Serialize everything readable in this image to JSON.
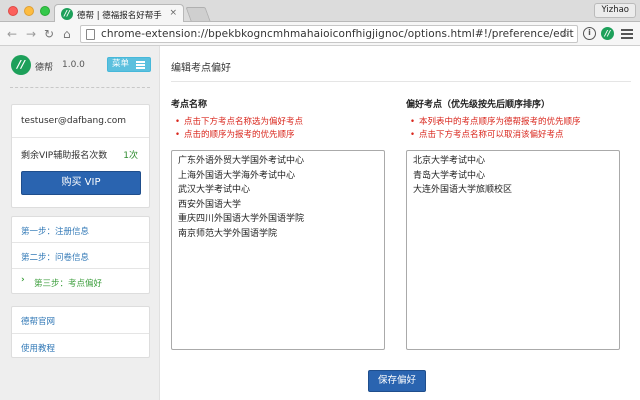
{
  "browser": {
    "tab_title": "德帮 | 德福报名好帮手",
    "tab_favicon_letter": "//",
    "tab_close": "×",
    "user_name": "Yizhao",
    "url": "chrome-extension://bpekbkogncmhmahaioiconfhigjignoc/options.html#!/preference/edit",
    "nav": {
      "back": "←",
      "forward": "→",
      "reload": "↻",
      "home": "⌂"
    },
    "star": "☆",
    "ext_info": "i",
    "ext_logo_letter": "//"
  },
  "sidebar": {
    "logo_letter": "//",
    "brand_name": "德帮",
    "version": "1.0.0",
    "menu_label": "菜单",
    "account": {
      "email": "testuser@dafbang.com",
      "vip_count_label": "剩余VIP辅助报名次数",
      "vip_count_value": "1次",
      "buy_vip_label": "购买 VIP"
    },
    "steps": [
      {
        "label": "第一步：注册信息",
        "active": false
      },
      {
        "label": "第二步：问卷信息",
        "active": false
      },
      {
        "label": "第三步：考点偏好",
        "active": true
      }
    ],
    "step_chevron": "›",
    "links": [
      {
        "label": "德帮官网"
      },
      {
        "label": "使用教程"
      }
    ]
  },
  "main": {
    "title": "编辑考点偏好",
    "left": {
      "heading": "考点名称",
      "hints": [
        "点击下方考点名称选为偏好考点",
        "点击的顺序为报考的优先顺序"
      ],
      "options": [
        "广东外语外贸大学国外考试中心",
        "上海外国语大学海外考试中心",
        "武汉大学考试中心",
        "西安外国语大学",
        "重庆四川外国语大学外国语学院",
        "南京师范大学外国语学院"
      ]
    },
    "right": {
      "heading": "偏好考点（优先级按先后顺序排序）",
      "hints": [
        "本列表中的考点顺序为德帮报考的优先顺序",
        "点击下方考点名称可以取消该偏好考点"
      ],
      "options": [
        "北京大学考试中心",
        "青岛大学考试中心",
        "大连外国语大学旅顺校区"
      ]
    },
    "save_label": "保存偏好"
  }
}
